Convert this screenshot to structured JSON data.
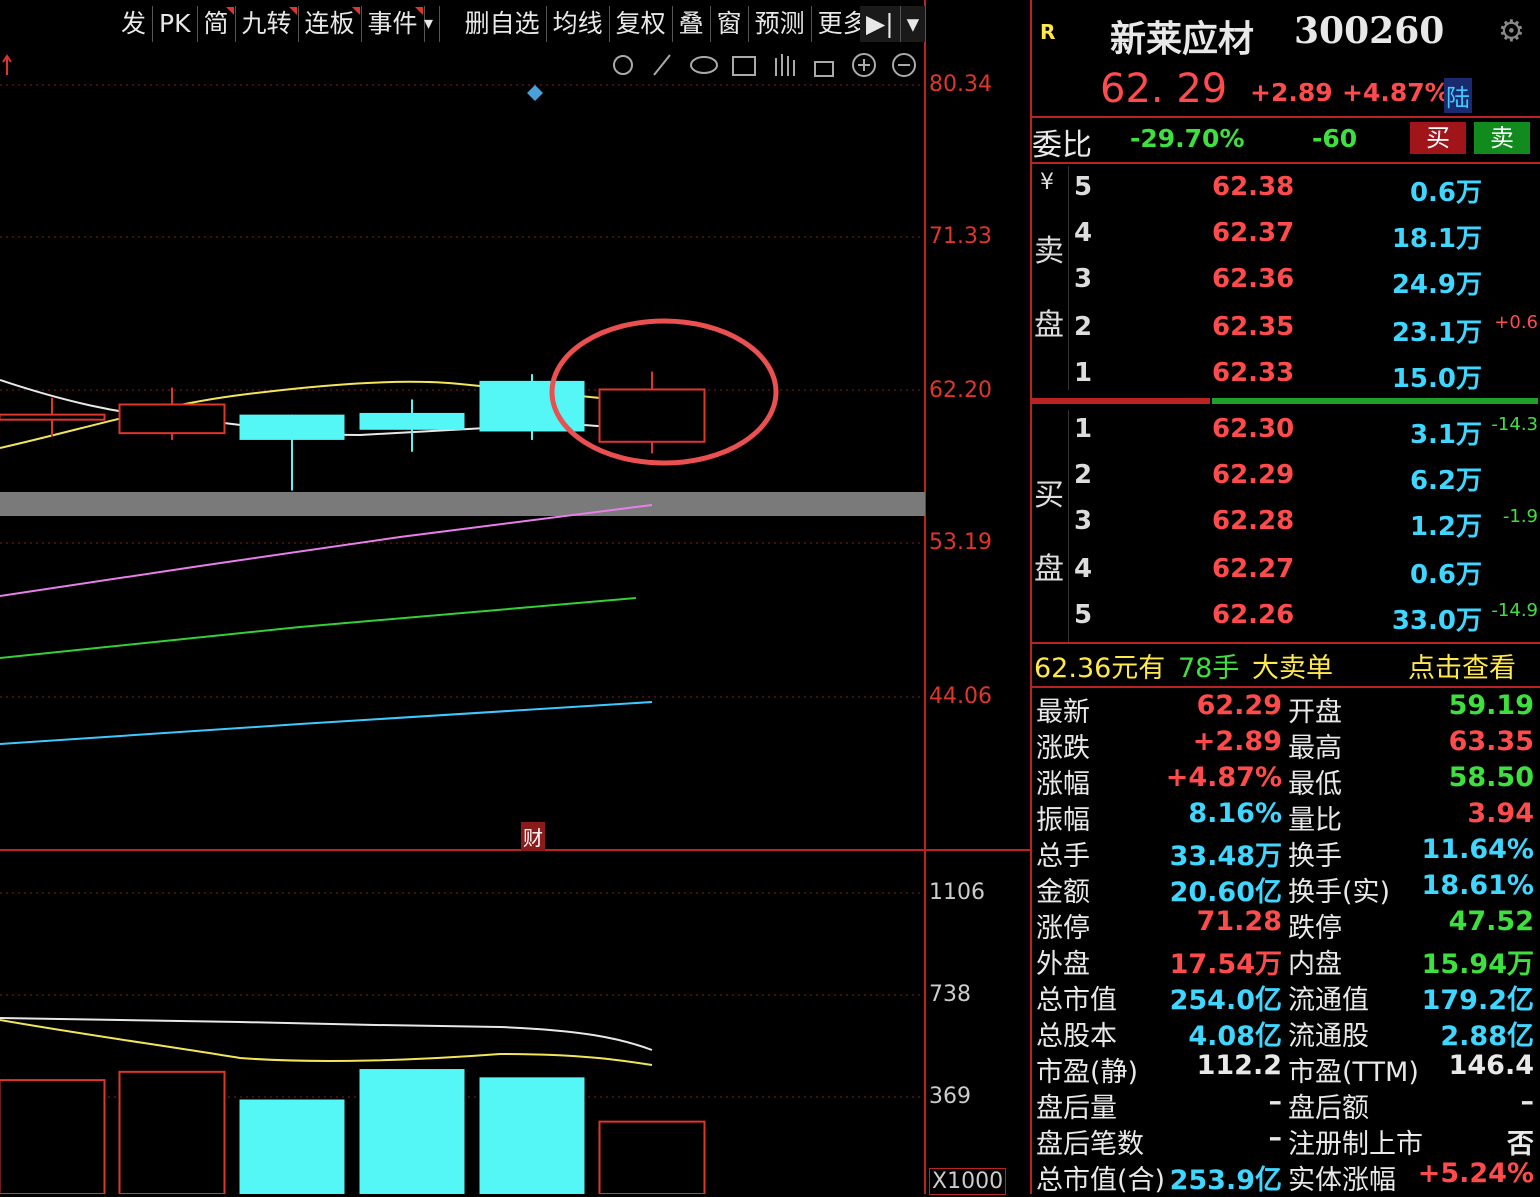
{
  "toolbar": {
    "items": [
      {
        "label": "发",
        "flag": false
      },
      {
        "label": "PK",
        "flag": false
      },
      {
        "label": "简",
        "flag": true
      },
      {
        "label": "九转",
        "flag": true
      },
      {
        "label": "连板",
        "flag": true
      },
      {
        "label": "事件",
        "flag": true
      },
      {
        "label": "删自选",
        "flag": false
      },
      {
        "label": "均线",
        "flag": false
      },
      {
        "label": "复权",
        "flag": false
      },
      {
        "label": "叠",
        "flag": false
      },
      {
        "label": "窗",
        "flag": false
      },
      {
        "label": "预测",
        "flag": false
      },
      {
        "label": "更多",
        "flag": false
      }
    ],
    "tools": [
      "settings-icon",
      "pen-icon",
      "eye-icon",
      "toolbox-icon",
      "hand-icon",
      "lock-icon",
      "zoom-in-icon",
      "zoom-out-icon"
    ]
  },
  "chart_data": {
    "type": "candlestick",
    "price_axis_ticks": [
      "80.34",
      "71.33",
      "62.20",
      "53.19",
      "44.06"
    ],
    "volume_axis_ticks": [
      "1106",
      "738",
      "369"
    ],
    "volume_unit": "X1000",
    "finance_marker": "财",
    "candles": [
      {
        "open": 60.8,
        "close": 60.5,
        "high": 61.8,
        "low": 59.5,
        "direction": "up"
      },
      {
        "open": 59.7,
        "close": 61.4,
        "high": 62.4,
        "low": 59.3,
        "direction": "up"
      },
      {
        "open": 59.3,
        "close": 60.8,
        "high": 58.5,
        "low": 56.3,
        "direction": "down"
      },
      {
        "open": 60.9,
        "close": 59.9,
        "high": 61.7,
        "low": 58.6,
        "direction": "down"
      },
      {
        "open": 59.8,
        "close": 62.8,
        "high": 63.2,
        "low": 59.3,
        "direction": "down"
      },
      {
        "open": 59.19,
        "close": 62.29,
        "high": 63.35,
        "low": 58.5,
        "direction": "up"
      }
    ],
    "volumes": [
      {
        "value": 430,
        "direction": "up"
      },
      {
        "value": 460,
        "direction": "up"
      },
      {
        "value": 360,
        "direction": "down"
      },
      {
        "value": 470,
        "direction": "down"
      },
      {
        "value": 440,
        "direction": "down"
      },
      {
        "value": 280,
        "direction": "up"
      }
    ],
    "highlight": "circle around last candle"
  },
  "quote": {
    "badge": "R",
    "name": "新莱应材",
    "code": "300260",
    "price": "62. 29",
    "change": "+2.89",
    "change_pct": "+4.87%",
    "market_tag": "陆",
    "weibi_label": "委比",
    "weibi_value": "-29.70%",
    "weicha_value": "-60",
    "buy_btn": "买",
    "sell_btn": "卖"
  },
  "orderbook": {
    "sell_label_1": "卖",
    "sell_label_2": "盘",
    "sell_symbol": "¥",
    "buy_label_1": "买",
    "buy_label_2": "盘",
    "asks": [
      {
        "idx": "5",
        "price": "62.38",
        "vol": "0.6万",
        "chg": ""
      },
      {
        "idx": "4",
        "price": "62.37",
        "vol": "18.1万",
        "chg": ""
      },
      {
        "idx": "3",
        "price": "62.36",
        "vol": "24.9万",
        "chg": ""
      },
      {
        "idx": "2",
        "price": "62.35",
        "vol": "23.1万",
        "chg": "+0.6"
      },
      {
        "idx": "1",
        "price": "62.33",
        "vol": "15.0万",
        "chg": ""
      }
    ],
    "bids": [
      {
        "idx": "1",
        "price": "62.30",
        "vol": "3.1万",
        "chg": "-14.3"
      },
      {
        "idx": "2",
        "price": "62.29",
        "vol": "6.2万",
        "chg": ""
      },
      {
        "idx": "3",
        "price": "62.28",
        "vol": "1.2万",
        "chg": "-1.9"
      },
      {
        "idx": "4",
        "price": "62.27",
        "vol": "0.6万",
        "chg": ""
      },
      {
        "idx": "5",
        "price": "62.26",
        "vol": "33.0万",
        "chg": "-14.9"
      }
    ]
  },
  "big_order": {
    "price_text": "62.36元有",
    "qty_text": "78手",
    "type_text": "大卖单",
    "action_text": "点击查看"
  },
  "stats": [
    {
      "l1": "最新",
      "v1": "62.29",
      "c1": "red",
      "l2": "开盘",
      "v2": "59.19",
      "c2": "green"
    },
    {
      "l1": "涨跌",
      "v1": "+2.89",
      "c1": "red",
      "l2": "最高",
      "v2": "63.35",
      "c2": "red"
    },
    {
      "l1": "涨幅",
      "v1": "+4.87%",
      "c1": "red",
      "l2": "最低",
      "v2": "58.50",
      "c2": "green"
    },
    {
      "l1": "振幅",
      "v1": "8.16%",
      "c1": "cyan",
      "l2": "量比",
      "v2": "3.94",
      "c2": "red"
    },
    {
      "l1": "总手",
      "v1": "33.48万",
      "c1": "cyan",
      "l2": "换手",
      "v2": "11.64%",
      "c2": "cyan"
    },
    {
      "l1": "金额",
      "v1": "20.60亿",
      "c1": "cyan",
      "l2": "换手(实)",
      "v2": "18.61%",
      "c2": "cyan"
    },
    {
      "l1": "涨停",
      "v1": "71.28",
      "c1": "red",
      "l2": "跌停",
      "v2": "47.52",
      "c2": "green"
    },
    {
      "l1": "外盘",
      "v1": "17.54万",
      "c1": "red",
      "l2": "内盘",
      "v2": "15.94万",
      "c2": "green"
    },
    {
      "l1": "总市值",
      "v1": "254.0亿",
      "c1": "cyan",
      "l2": "流通值",
      "v2": "179.2亿",
      "c2": "cyan"
    },
    {
      "l1": "总股本",
      "v1": "4.08亿",
      "c1": "cyan",
      "l2": "流通股",
      "v2": "2.88亿",
      "c2": "cyan"
    },
    {
      "l1": "市盈(静)",
      "v1": "112.2",
      "c1": "white",
      "l2": "市盈(TTM)",
      "v2": "146.4",
      "c2": "white"
    },
    {
      "l1": "盘后量",
      "v1": "–",
      "c1": "white",
      "l2": "盘后额",
      "v2": "–",
      "c2": "white"
    },
    {
      "l1": "盘后笔数",
      "v1": "–",
      "c1": "white",
      "l2": "注册制上市",
      "v2": "否",
      "c2": "white"
    },
    {
      "l1": "总市值(合)",
      "v1": "253.9亿",
      "c1": "cyan",
      "l2": "实体涨幅",
      "v2": "+5.24%",
      "c2": "red"
    }
  ],
  "colors": {
    "up": "#e0352b",
    "down": "#54f6f6",
    "accent_red": "#b22222"
  }
}
